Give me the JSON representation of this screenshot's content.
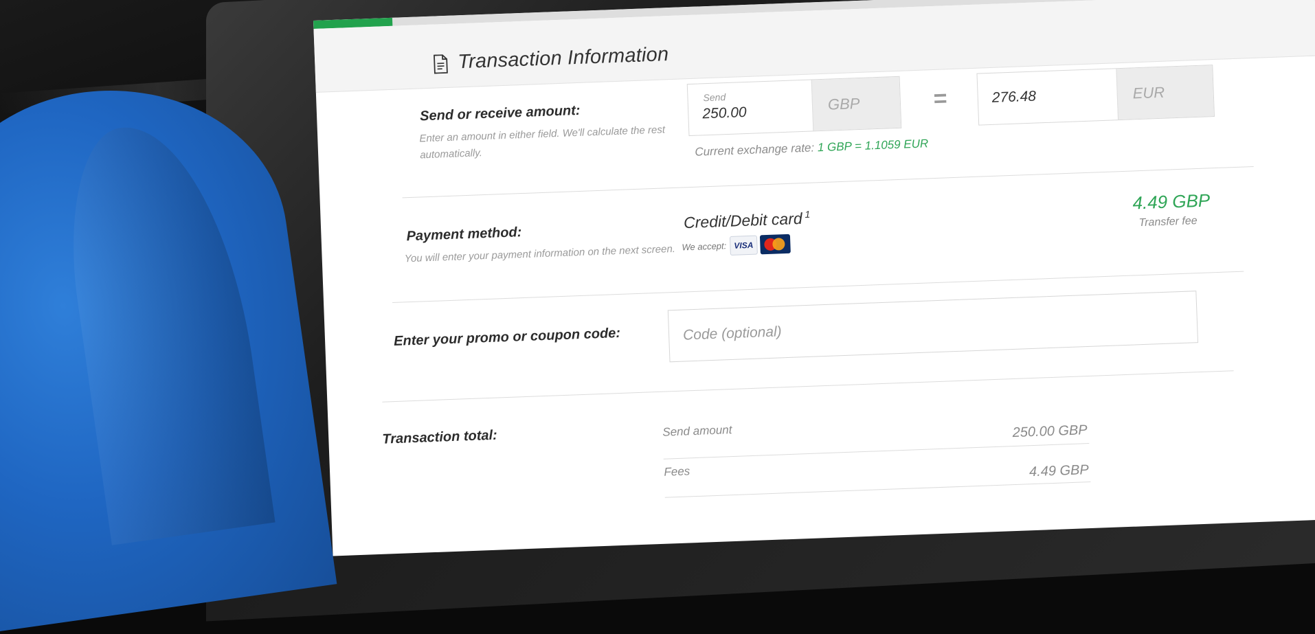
{
  "header": {
    "title": "Transaction Information",
    "icon": "document-icon"
  },
  "amount_section": {
    "label": "Send or receive amount:",
    "hint_line1": "Enter an amount in either field. We'll calculate the rest",
    "hint_line2": "automatically.",
    "send": {
      "field_label": "Send",
      "value": "250.00",
      "currency": "GBP"
    },
    "equals": "=",
    "receive": {
      "value": "276.48",
      "currency": "EUR"
    },
    "rate_prefix": "Current exchange rate:",
    "rate_value": "1 GBP = 1.1059 EUR"
  },
  "payment_section": {
    "label": "Payment method:",
    "hint": "You will enter your payment information on the next screen.",
    "method": "Credit/Debit card",
    "method_footnote": "1",
    "accept_label": "We accept:",
    "card_logos": [
      "visa-logo",
      "mastercard-logo"
    ],
    "visa_text": "VISA",
    "fee_amount": "4.49 GBP",
    "fee_label": "Transfer fee"
  },
  "promo_section": {
    "label": "Enter your promo or coupon code:",
    "placeholder": "Code (optional)",
    "value": ""
  },
  "total_section": {
    "label": "Transaction total:",
    "rows": [
      {
        "label": "Send amount",
        "value": "250.00 GBP"
      },
      {
        "label": "Fees",
        "value": "4.49 GBP"
      }
    ]
  },
  "colors": {
    "accent_green": "#2fa556",
    "brand_green": "#22a24d",
    "shirt_blue": "#1f66c2"
  }
}
